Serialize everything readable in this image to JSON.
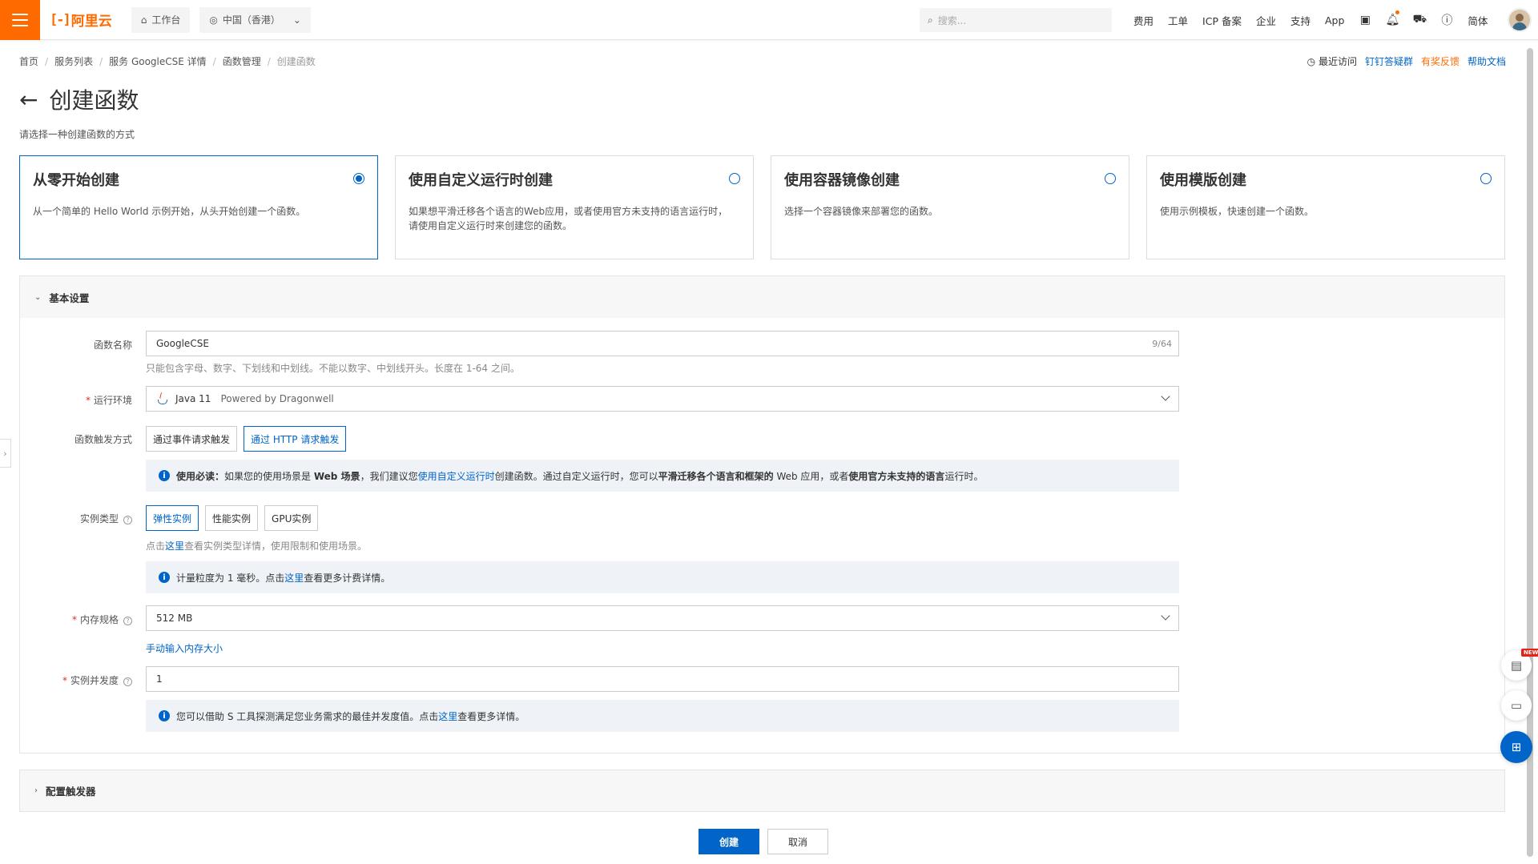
{
  "topbar": {
    "logo_text": "阿里云",
    "workbench": "工作台",
    "region": "中国（香港）",
    "search_placeholder": "搜索...",
    "links": [
      "费用",
      "工单",
      "ICP 备案",
      "企业",
      "支持",
      "App"
    ],
    "lang": "简体"
  },
  "breadcrumb": [
    "首页",
    "服务列表",
    "服务 GoogleCSE 详情",
    "函数管理",
    "创建函数"
  ],
  "right_links": {
    "recent": "最近访问",
    "dingtalk": "钉钉答疑群",
    "feedback": "有奖反馈",
    "help": "帮助文档"
  },
  "page": {
    "title": "创建函数",
    "subtitle": "请选择一种创建函数的方式"
  },
  "cards": [
    {
      "title": "从零开始创建",
      "desc": "从一个简单的 Hello World 示例开始，从头开始创建一个函数。",
      "selected": true
    },
    {
      "title": "使用自定义运行时创建",
      "desc": "如果想平滑迁移各个语言的Web应用，或者使用官方未支持的语言运行时，请使用自定义运行时来创建您的函数。",
      "selected": false
    },
    {
      "title": "使用容器镜像创建",
      "desc": "选择一个容器镜像来部署您的函数。",
      "selected": false
    },
    {
      "title": "使用模版创建",
      "desc": "使用示例模板，快速创建一个函数。",
      "selected": false
    }
  ],
  "basic": {
    "header": "基本设置",
    "fn_name_label": "函数名称",
    "fn_name_value": "GoogleCSE",
    "fn_name_count": "9/64",
    "fn_name_hint": "只能包含字母、数字、下划线和中划线。不能以数字、中划线开头。长度在 1-64 之间。",
    "runtime_label": "运行环境",
    "runtime_value": "Java 11",
    "runtime_sub": "Powered by Dragonwell",
    "trigger_label": "函数触发方式",
    "trigger_options": [
      "通过事件请求触发",
      "通过 HTTP 请求触发"
    ],
    "trigger_selected": 1,
    "notice1_bold": "使用必读：",
    "notice1_a": "如果您的使用场景是 ",
    "notice1_web": "Web 场景",
    "notice1_b": "，我们建议您",
    "notice1_link": "使用自定义运行时",
    "notice1_c": "创建函数。通过自定义运行时，您可以",
    "notice1_d": "平滑迁移各个语言和框架的",
    "notice1_e": " Web 应用，或者",
    "notice1_f": "使用官方未支持的语言",
    "notice1_g": "运行时。",
    "instance_label": "实例类型",
    "instance_options": [
      "弹性实例",
      "性能实例",
      "GPU实例"
    ],
    "instance_hint_a": "点击",
    "instance_hint_link": "这里",
    "instance_hint_b": "查看实例类型详情，使用限制和使用场景。",
    "notice2_a": "计量粒度为 1 毫秒。点击",
    "notice2_link": "这里",
    "notice2_b": "查看更多计费详情。",
    "memory_label": "内存规格",
    "memory_value": "512 MB",
    "memory_manual": "手动输入内存大小",
    "concurrency_label": "实例并发度",
    "concurrency_value": "1",
    "notice3_a": "您可以借助 S 工具探测满足您业务需求的最佳并发度值。点击",
    "notice3_link": "这里",
    "notice3_b": "查看更多详情。"
  },
  "trigger_panel": {
    "header": "配置触发器"
  },
  "footer": {
    "create": "创建",
    "cancel": "取消"
  },
  "float": {
    "new_tag": "NEW"
  },
  "colors": {
    "brand": "#ff6a00",
    "primary": "#0064c8"
  }
}
